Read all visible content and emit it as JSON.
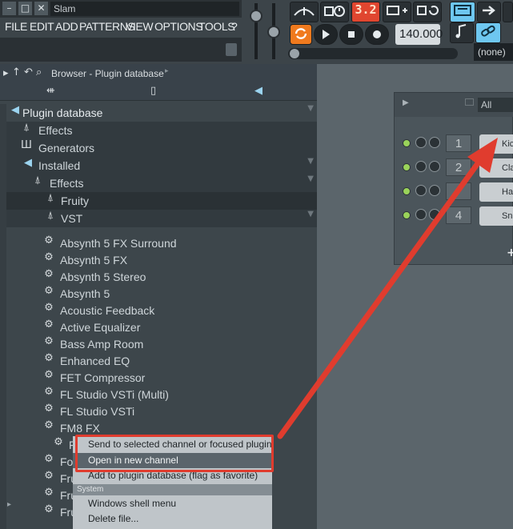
{
  "window": {
    "title_field": "Slam",
    "controls": {
      "minimize": "–",
      "maximize": "□",
      "close": "✕"
    }
  },
  "menu": [
    "FILE",
    "EDIT",
    "ADD",
    "PATTERNS",
    "VIEW",
    "OPTIONS",
    "TOOLS",
    "?"
  ],
  "transport": {
    "counter": "3.2",
    "tempo": "140.000",
    "pattern_selector": "(none)"
  },
  "browser": {
    "title": "Browser - Plugin database",
    "tree": [
      {
        "label": "Plugin database",
        "icon": "speaker-icon"
      },
      {
        "label": "Effects",
        "icon": "plug-icon"
      },
      {
        "label": "Generators",
        "icon": "piano-icon"
      },
      {
        "label": "Installed",
        "icon": "speaker-icon"
      },
      {
        "label": "Effects",
        "icon": "plug-icon"
      },
      {
        "label": "Fruity",
        "icon": "plug-icon"
      },
      {
        "label": "VST",
        "icon": "plug-icon"
      }
    ],
    "plugins": [
      "Absynth 5 FX Surround",
      "Absynth 5 FX",
      "Absynth 5 Stereo",
      "Absynth 5",
      "Acoustic Feedback",
      "Active Equalizer",
      "Bass Amp Room",
      "Enhanced EQ",
      "FET Compressor",
      "FL Studio VSTi (Multi)",
      "FL Studio VSTi",
      "FM8 FX"
    ],
    "partial_rows": [
      "F",
      "Fo",
      "Fru",
      "Fru",
      "Fru"
    ]
  },
  "channel_rack": {
    "filter": "All",
    "channels": [
      {
        "number": "1",
        "name": "Kic"
      },
      {
        "number": "2",
        "name": "Cla"
      },
      {
        "number": "",
        "name": "Ha"
      },
      {
        "number": "4",
        "name": "Sna"
      }
    ],
    "add_label": "+"
  },
  "context_menu": {
    "items_top": [
      "Send to selected channel or focused plugin",
      "Open in new channel",
      "Add to plugin database (flag as favorite)"
    ],
    "section": "System",
    "items_bottom": [
      "Windows shell menu",
      "Delete file..."
    ]
  },
  "colors": {
    "annotation_red": "#e03c2e",
    "accent_orange": "#f07a1e",
    "accent_blue": "#6ec7f0",
    "led_green": "#9ad35a"
  }
}
